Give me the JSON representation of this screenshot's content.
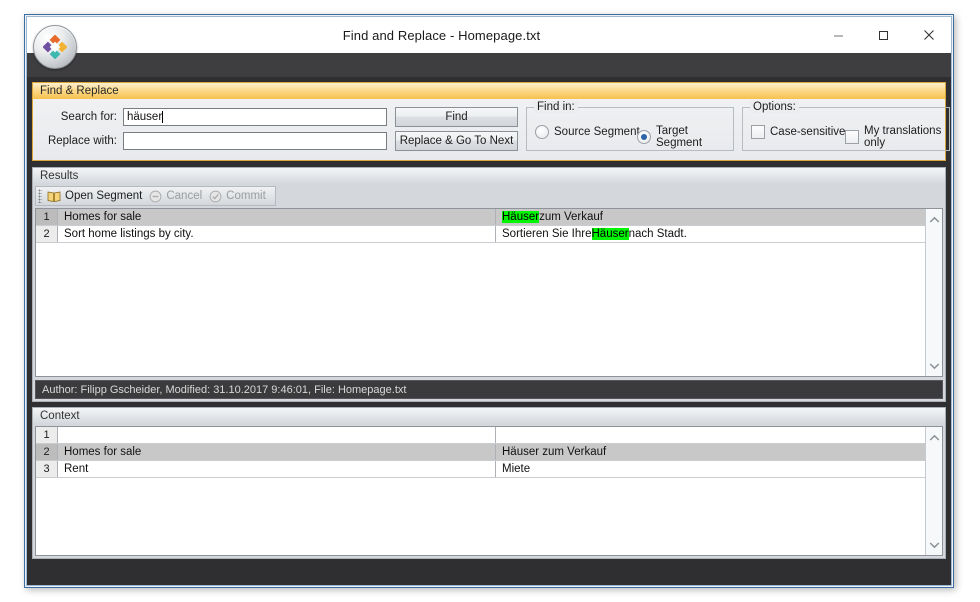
{
  "window": {
    "title": "Find and Replace - Homepage.txt",
    "app_icon": "trados-diamond-icon",
    "controls": {
      "minimize": "minimize-icon",
      "maximize": "maximize-icon",
      "close": "close-icon"
    }
  },
  "find_replace": {
    "caption": "Find & Replace",
    "search_label": "Search for:",
    "search_value": "häuser",
    "search_placeholder": "",
    "replace_label": "Replace with:",
    "replace_value": "",
    "replace_placeholder": "",
    "find_button": "Find",
    "replace_next_button": "Replace & Go To Next",
    "find_in": {
      "title": "Find in:",
      "options": [
        {
          "label": "Source Segment",
          "selected": false
        },
        {
          "label": "Target Segment",
          "selected": true
        }
      ]
    },
    "options": {
      "title": "Options:",
      "items": [
        {
          "label": "Case-sensitive",
          "checked": false
        },
        {
          "label": "My translations only",
          "checked": false
        }
      ]
    }
  },
  "results": {
    "caption": "Results",
    "toolbar": {
      "open_segment": "Open Segment",
      "open_segment_icon": "book-icon",
      "cancel": "Cancel",
      "cancel_icon": "cancel-circle-icon",
      "commit": "Commit",
      "commit_icon": "check-circle-icon"
    },
    "rows": [
      {
        "num": "1",
        "source": "Homes for sale",
        "target_pre": "",
        "target_hl": "Häuser",
        "target_post": " zum Verkauf",
        "selected": true
      },
      {
        "num": "2",
        "source": "Sort home listings by city.",
        "target_pre": "Sortieren Sie Ihre ",
        "target_hl": "Häuser",
        "target_post": " nach Stadt.",
        "selected": false
      }
    ],
    "status_bar": "Author: Filipp Gscheider, Modified: 31.10.2017 9:46:01, File: Homepage.txt"
  },
  "context": {
    "caption": "Context",
    "rows": [
      {
        "num": "1",
        "source": "",
        "target": "",
        "selected": false
      },
      {
        "num": "2",
        "source": "Homes for sale",
        "target": "Häuser zum Verkauf",
        "selected": true
      },
      {
        "num": "3",
        "source": "Rent",
        "target": "Miete",
        "selected": false
      }
    ]
  },
  "colors": {
    "highlight_green": "#00f500",
    "caption_orange": "#f7c14f",
    "radio_blue": "#2c64a8",
    "window_border": "#3a6ea5"
  }
}
